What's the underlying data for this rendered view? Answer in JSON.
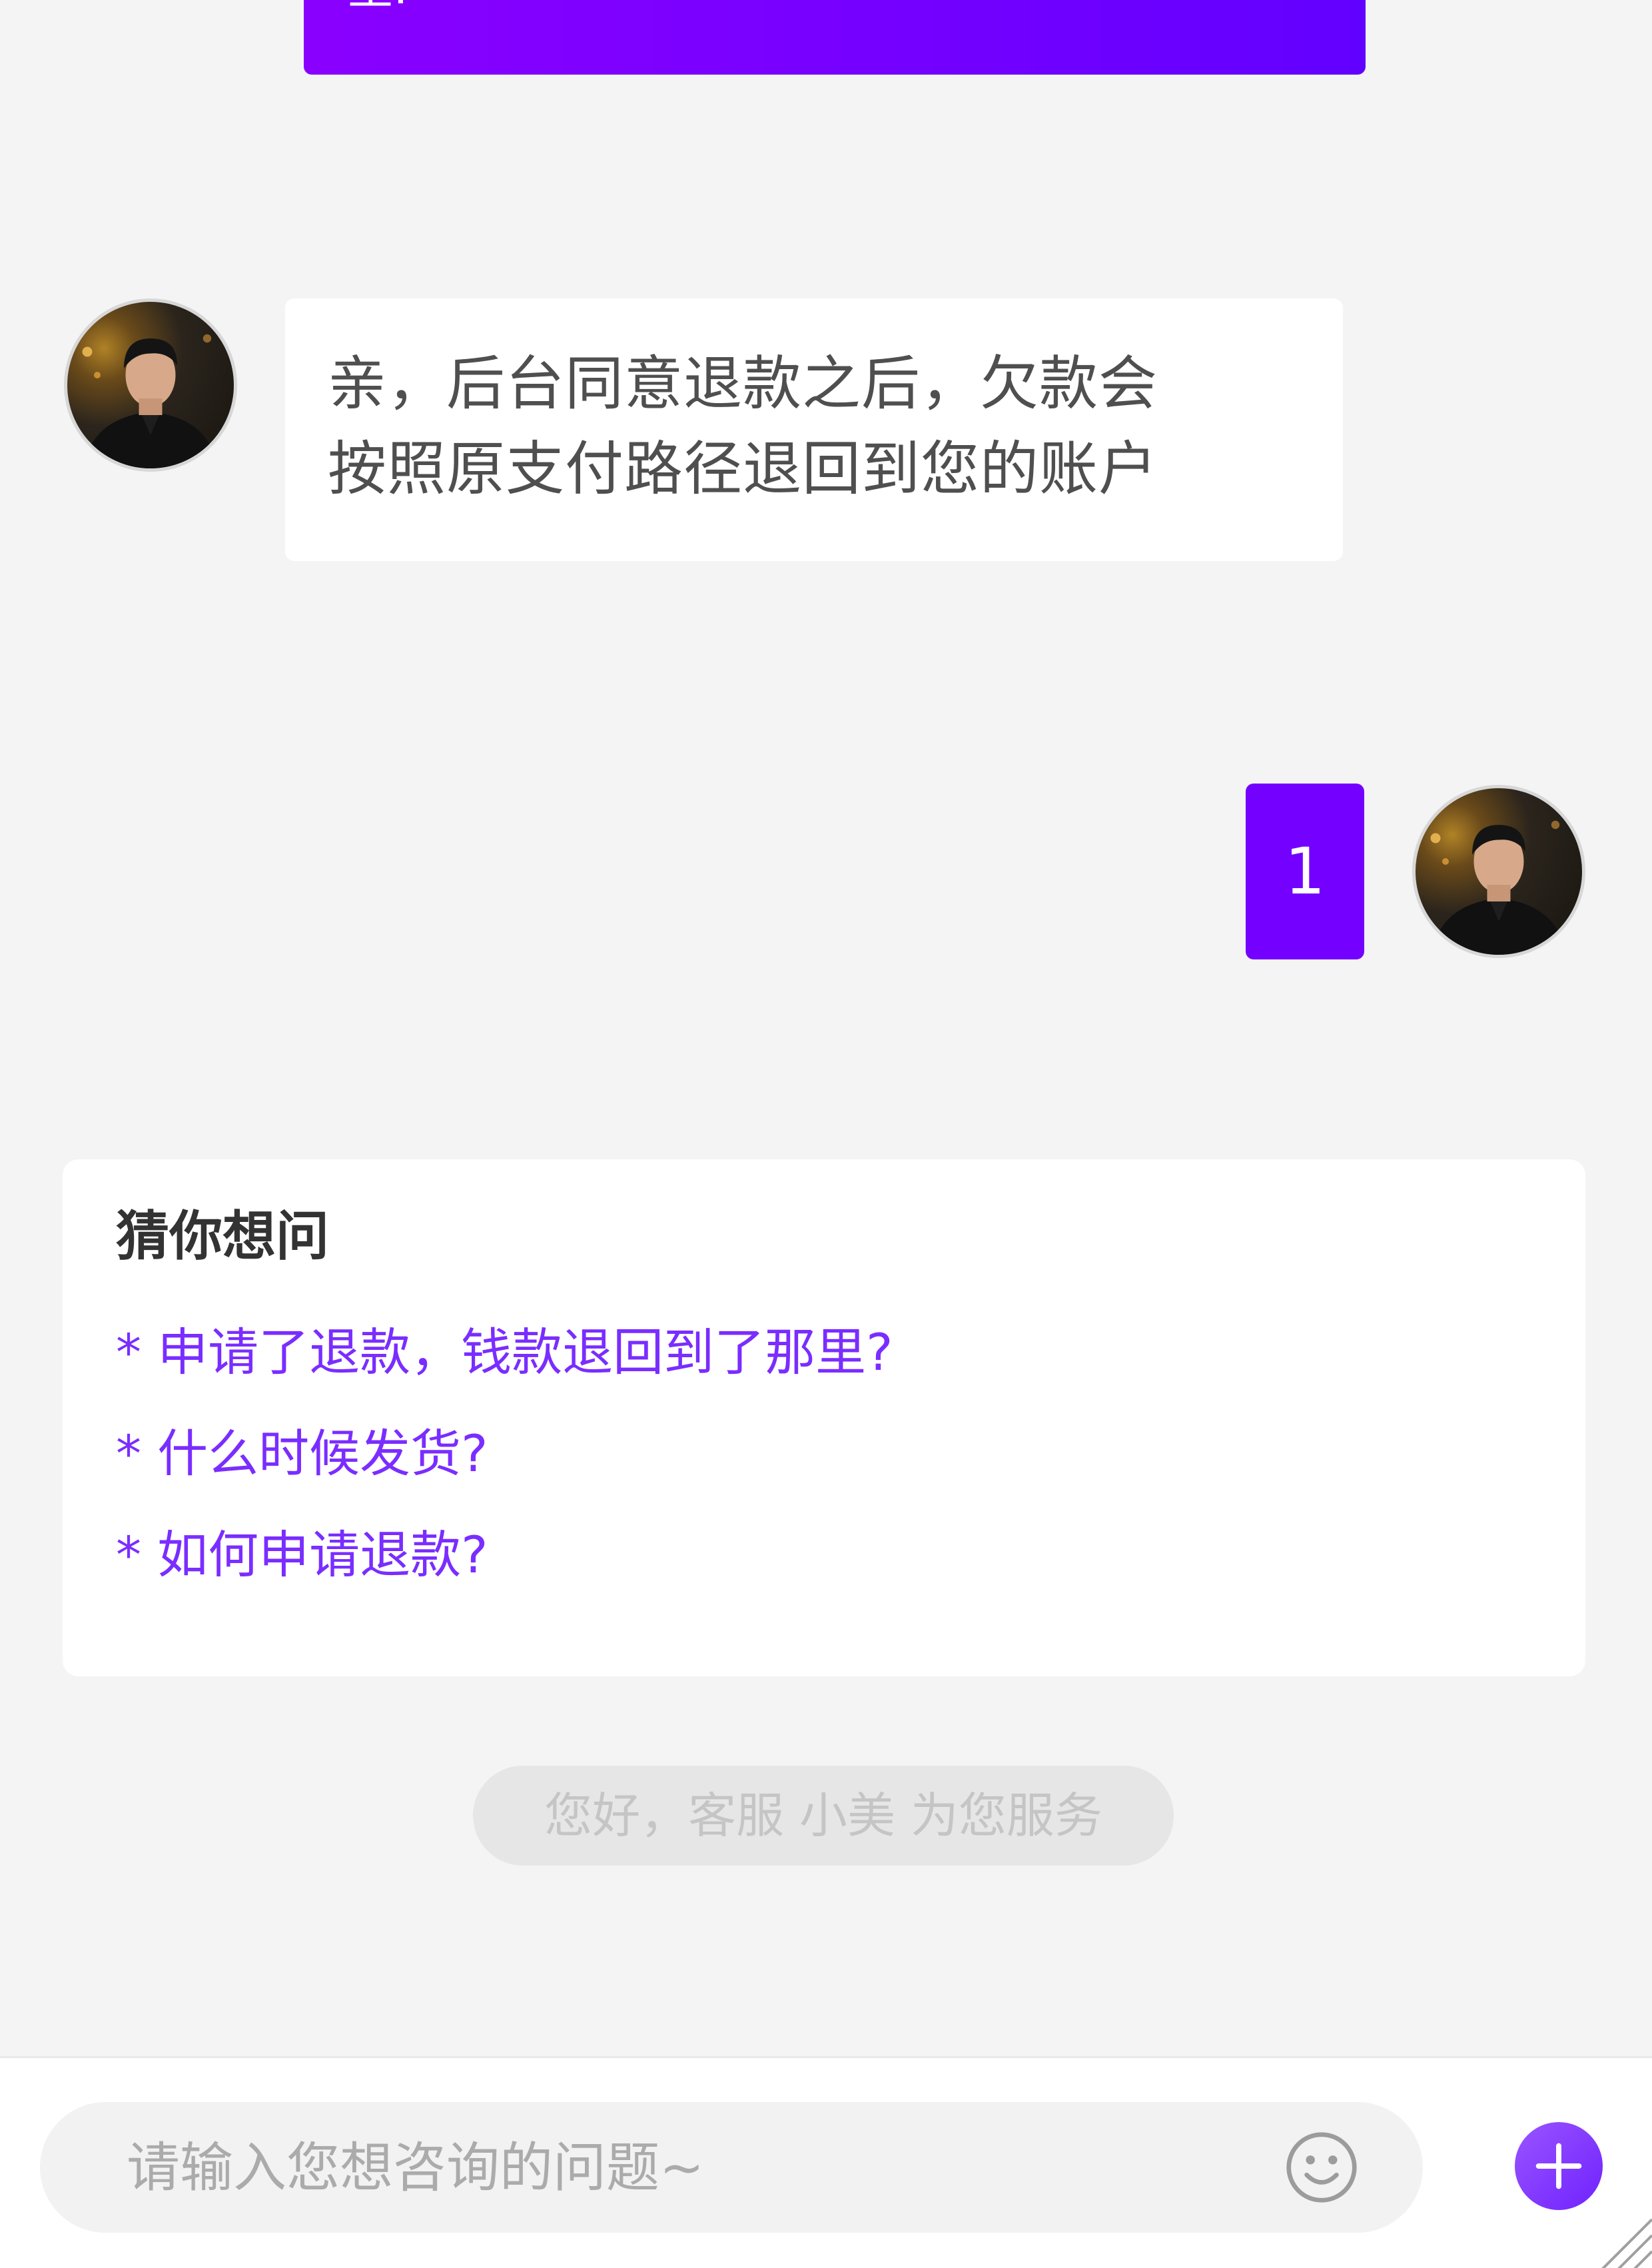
{
  "previous_message": {
    "text": "里:"
  },
  "agent_message": {
    "lines": [
      "亲，后台同意退款之后，欠款会",
      "按照原支付路径退回到您的账户"
    ]
  },
  "user_message": {
    "text": "1"
  },
  "suggestions": {
    "title": "猜你想问",
    "items": [
      "* 申请了退款，钱款退回到了那里?",
      "* 什么时候发货?",
      "* 如何申请退款?"
    ]
  },
  "service_notice": {
    "text": "您好，客服 小美 为您服务"
  },
  "composer": {
    "placeholder": "请输入您想咨询的问题~",
    "emoji_icon": "smiley-icon",
    "plus_icon": "plus-icon"
  },
  "colors": {
    "accent": "#7400ff",
    "link": "#7a2dff",
    "background": "#f4f4f5"
  }
}
